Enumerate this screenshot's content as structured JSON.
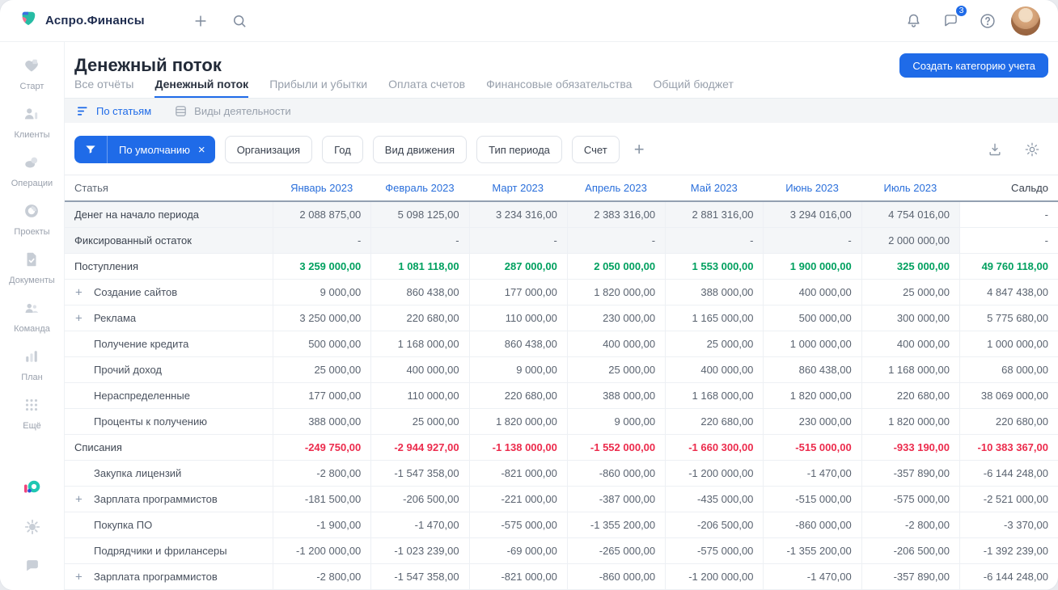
{
  "topbar": {
    "brand": "Аспро.Финансы",
    "chat_badge": "3"
  },
  "sidebar": {
    "items": [
      {
        "icon": "start-icon",
        "label": "Старт"
      },
      {
        "icon": "clients-icon",
        "label": "Клиенты"
      },
      {
        "icon": "operations-icon",
        "label": "Операции"
      },
      {
        "icon": "projects-icon",
        "label": "Проекты"
      },
      {
        "icon": "documents-icon",
        "label": "Документы"
      },
      {
        "icon": "team-icon",
        "label": "Команда"
      },
      {
        "icon": "plan-icon",
        "label": "План"
      },
      {
        "icon": "more-icon",
        "label": "Ещё"
      }
    ]
  },
  "page": {
    "title": "Денежный поток",
    "create_button": "Создать категорию учета"
  },
  "tabs": [
    {
      "label": "Все отчёты",
      "active": false
    },
    {
      "label": "Денежный поток",
      "active": true
    },
    {
      "label": "Прибыли и убытки",
      "active": false
    },
    {
      "label": "Оплата счетов",
      "active": false
    },
    {
      "label": "Финансовые обязательства",
      "active": false
    },
    {
      "label": "Общий бюджет",
      "active": false
    }
  ],
  "subtabs": [
    {
      "icon": "by-articles-icon",
      "label": "По статьям",
      "active": true
    },
    {
      "icon": "activity-types-icon",
      "label": "Виды деятельности",
      "active": false
    }
  ],
  "filters": {
    "active": "По умолчанию",
    "chips": [
      "Организация",
      "Год",
      "Вид движения",
      "Тип периода",
      "Счет"
    ]
  },
  "colors": {
    "primary_blue": "#1F6BE8",
    "positive_green": "#00A05F",
    "negative_red": "#EC2B4C"
  },
  "table": {
    "col_article": "Статья",
    "col_saldo": "Сальдо",
    "months": [
      "Январь 2023",
      "Февраль 2023",
      "Март 2023",
      "Апрель 2023",
      "Май 2023",
      "Июнь 2023",
      "Июль 2023"
    ],
    "rows": [
      {
        "label": "Денег на начало периода",
        "indent": 0,
        "plus": false,
        "shaded": true,
        "tone": "none",
        "values": [
          "2 088 875,00",
          "5 098 125,00",
          "3 234 316,00",
          "2 383 316,00",
          "2 881 316,00",
          "3 294 016,00",
          "4 754 016,00",
          "-"
        ]
      },
      {
        "label": "Фиксированный остаток",
        "indent": 0,
        "plus": false,
        "shaded": true,
        "tone": "none",
        "values": [
          "-",
          "-",
          "-",
          "-",
          "-",
          "-",
          "2 000 000,00",
          "-"
        ]
      },
      {
        "label": "Поступления",
        "indent": 0,
        "plus": false,
        "shaded": false,
        "tone": "green",
        "values": [
          "3 259 000,00",
          "1 081 118,00",
          "287 000,00",
          "2 050 000,00",
          "1 553 000,00",
          "1 900 000,00",
          "325 000,00",
          "49 760 118,00"
        ]
      },
      {
        "label": "Создание сайтов",
        "indent": 1,
        "plus": true,
        "shaded": false,
        "tone": "none",
        "values": [
          "9 000,00",
          "860 438,00",
          "177 000,00",
          "1 820 000,00",
          "388 000,00",
          "400 000,00",
          "25 000,00",
          "4 847 438,00"
        ]
      },
      {
        "label": "Реклама",
        "indent": 1,
        "plus": true,
        "shaded": false,
        "tone": "none",
        "values": [
          "3 250 000,00",
          "220 680,00",
          "110 000,00",
          "230 000,00",
          "1 165 000,00",
          "500 000,00",
          "300 000,00",
          "5 775 680,00"
        ]
      },
      {
        "label": "Получение кредита",
        "indent": 1,
        "plus": false,
        "shaded": false,
        "tone": "none",
        "values": [
          "500 000,00",
          "1 168 000,00",
          "860 438,00",
          "400 000,00",
          "25 000,00",
          "1 000 000,00",
          "400 000,00",
          "1 000 000,00"
        ]
      },
      {
        "label": "Прочий доход",
        "indent": 1,
        "plus": false,
        "shaded": false,
        "tone": "none",
        "values": [
          "25 000,00",
          "400 000,00",
          "9 000,00",
          "25 000,00",
          "400 000,00",
          "860 438,00",
          "1 168 000,00",
          "68 000,00"
        ]
      },
      {
        "label": "Нераспределенные",
        "indent": 1,
        "plus": false,
        "shaded": false,
        "tone": "none",
        "values": [
          "177 000,00",
          "110 000,00",
          "220 680,00",
          "388 000,00",
          "1 168 000,00",
          "1 820 000,00",
          "220 680,00",
          "38 069 000,00"
        ]
      },
      {
        "label": "Проценты к получению",
        "indent": 1,
        "plus": false,
        "shaded": false,
        "tone": "none",
        "values": [
          "388 000,00",
          "25 000,00",
          "1 820 000,00",
          "9 000,00",
          "220 680,00",
          "230 000,00",
          "1 820 000,00",
          "220 680,00"
        ]
      },
      {
        "label": "Списания",
        "indent": 0,
        "plus": false,
        "shaded": false,
        "tone": "red",
        "values": [
          "-249 750,00",
          "-2 944 927,00",
          "-1 138 000,00",
          "-1 552 000,00",
          "-1 660 300,00",
          "-515 000,00",
          "-933 190,00",
          "-10 383 367,00"
        ]
      },
      {
        "label": "Закупка лицензий",
        "indent": 1,
        "plus": false,
        "shaded": false,
        "tone": "none",
        "values": [
          "-2 800,00",
          "-1 547 358,00",
          "-821 000,00",
          "-860 000,00",
          "-1 200 000,00",
          "-1 470,00",
          "-357 890,00",
          "-6 144 248,00"
        ]
      },
      {
        "label": "Зарплата программистов",
        "indent": 1,
        "plus": true,
        "shaded": false,
        "tone": "none",
        "values": [
          "-181 500,00",
          "-206 500,00",
          "-221 000,00",
          "-387 000,00",
          "-435 000,00",
          "-515 000,00",
          "-575 000,00",
          "-2 521 000,00"
        ]
      },
      {
        "label": "Покупка ПО",
        "indent": 1,
        "plus": false,
        "shaded": false,
        "tone": "none",
        "values": [
          "-1 900,00",
          "-1 470,00",
          "-575 000,00",
          "-1 355 200,00",
          "-206 500,00",
          "-860 000,00",
          "-2 800,00",
          "-3 370,00"
        ]
      },
      {
        "label": "Подрядчики и фрилансеры",
        "indent": 1,
        "plus": false,
        "shaded": false,
        "tone": "none",
        "values": [
          "-1 200 000,00",
          "-1 023 239,00",
          "-69 000,00",
          "-265 000,00",
          "-575 000,00",
          "-1 355 200,00",
          "-206 500,00",
          "-1 392 239,00"
        ]
      },
      {
        "label": "Зарплата программистов",
        "indent": 1,
        "plus": true,
        "shaded": false,
        "tone": "none",
        "values": [
          "-2 800,00",
          "-1 547 358,00",
          "-821 000,00",
          "-860 000,00",
          "-1 200 000,00",
          "-1 470,00",
          "-357 890,00",
          "-6 144 248,00"
        ]
      }
    ]
  }
}
